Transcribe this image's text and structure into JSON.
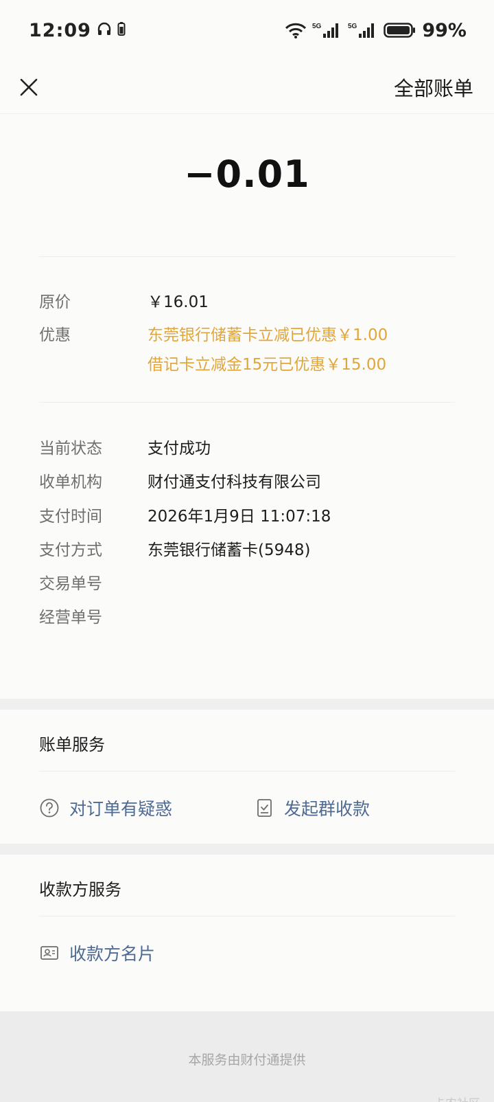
{
  "status_bar": {
    "time": "12:09",
    "battery_pct": "99%",
    "icons": [
      "headphones-icon",
      "battery-small-icon",
      "wifi-icon",
      "signal-5g-icon",
      "signal-5g-icon",
      "battery-icon"
    ]
  },
  "nav": {
    "close_icon": "close-icon",
    "all_bills": "全部账单"
  },
  "amount": "−0.01",
  "price": {
    "original_label": "原价",
    "original_value": "￥16.01",
    "discount_label": "优惠",
    "discount_lines": [
      "东莞银行储蓄卡立减已优惠￥1.00",
      "借记卡立减金15元已优惠￥15.00"
    ],
    "discount_color": "#e0a63a"
  },
  "details": [
    {
      "label": "当前状态",
      "value": "支付成功"
    },
    {
      "label": "收单机构",
      "value": "财付通支付科技有限公司"
    },
    {
      "label": "支付时间",
      "value": "2026年1月9日 11:07:18"
    },
    {
      "label": "支付方式",
      "value": "东莞银行储蓄卡(5948)"
    },
    {
      "label": "交易单号",
      "value": ""
    },
    {
      "label": "经营单号",
      "value": ""
    }
  ],
  "bill_service": {
    "title": "账单服务",
    "items": [
      {
        "label": "对订单有疑惑",
        "icon": "question-circle-icon"
      },
      {
        "label": "发起群收款",
        "icon": "group-collect-icon"
      }
    ]
  },
  "payee_service": {
    "title": "收款方服务",
    "items": [
      {
        "label": "收款方名片",
        "icon": "contact-card-icon"
      }
    ]
  },
  "footer": {
    "text": "本服务由财付通提供",
    "watermark": "卡农社区"
  },
  "colors": {
    "link": "#4e6a93",
    "discount": "#e0a63a"
  }
}
